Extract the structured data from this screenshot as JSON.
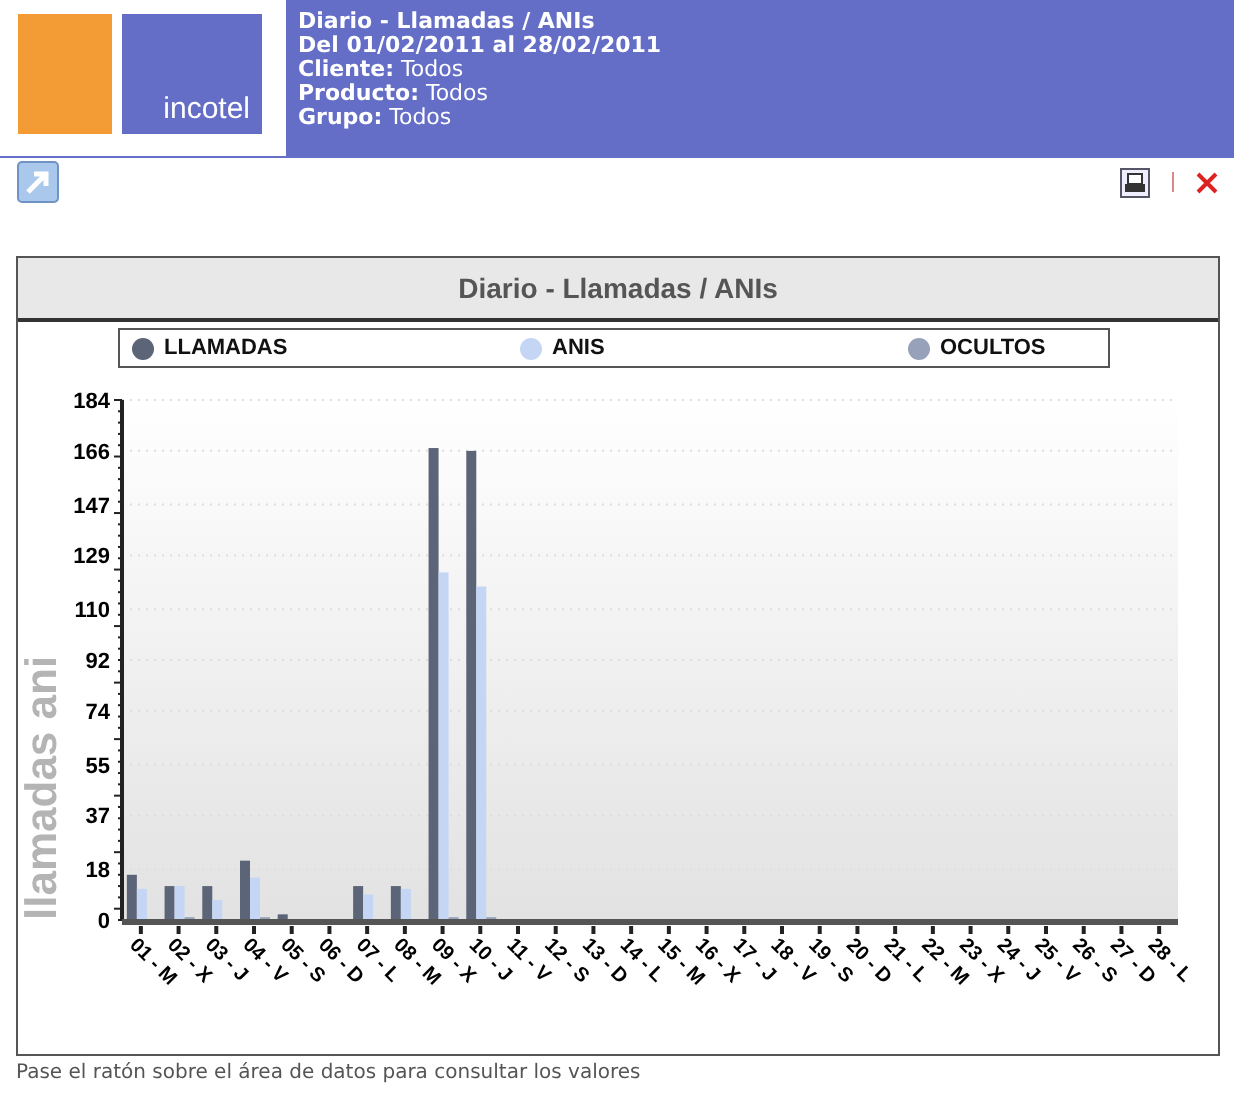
{
  "header": {
    "logo_text": "incotel",
    "lines": [
      "**Diario - Llamadas / ANIs**",
      "**Del 01/02/2011 al 28/02/2011**",
      "**Cliente:** Todos",
      "**Producto:** Todos",
      "**Grupo:** Todos"
    ]
  },
  "chart": {
    "title": "Diario - Llamadas / ANIs",
    "chart_data": {
      "type": "bar",
      "ylabel": "llamadas ani",
      "categories": [
        "01 - M",
        "02 - X",
        "03 - J",
        "04 - V",
        "05 - S",
        "06 - D",
        "07 - L",
        "08 - M",
        "09 - X",
        "10 - J",
        "11 - V",
        "12 - S",
        "13 - D",
        "14 - L",
        "15 - M",
        "16 - X",
        "17 - J",
        "18 - V",
        "19 - S",
        "20 - D",
        "21 - L",
        "22 - M",
        "23 - X",
        "24 - J",
        "25 - V",
        "26 - S",
        "27 - D",
        "28 - L"
      ],
      "series": [
        {
          "name": "LLAMADAS",
          "color": "#5c6478",
          "values": [
            16,
            12,
            12,
            21,
            2,
            0,
            12,
            12,
            167,
            166,
            0,
            0,
            0,
            0,
            0,
            0,
            0,
            0,
            0,
            0,
            0,
            0,
            0,
            0,
            0,
            0,
            0,
            0
          ]
        },
        {
          "name": "ANIS",
          "color": "#c4d6f4",
          "values": [
            11,
            12,
            7,
            15,
            0,
            0,
            9,
            11,
            123,
            118,
            0,
            0,
            0,
            0,
            0,
            0,
            0,
            0,
            0,
            0,
            0,
            0,
            0,
            0,
            0,
            0,
            0,
            0
          ]
        },
        {
          "name": "OCULTOS",
          "color": "#97a2ba",
          "values": [
            0,
            1,
            0,
            1,
            0,
            0,
            0,
            0,
            1,
            1,
            0,
            0,
            0,
            0,
            0,
            0,
            0,
            0,
            0,
            0,
            0,
            0,
            0,
            0,
            0,
            0,
            0,
            0
          ]
        }
      ],
      "grid": true,
      "legend": true,
      "ylim": [
        0,
        184
      ],
      "yticks": [
        0,
        18,
        37,
        55,
        74,
        92,
        110,
        129,
        147,
        166,
        184
      ]
    }
  },
  "footer": "Pase el ratón sobre el área de datos para consultar los valores"
}
